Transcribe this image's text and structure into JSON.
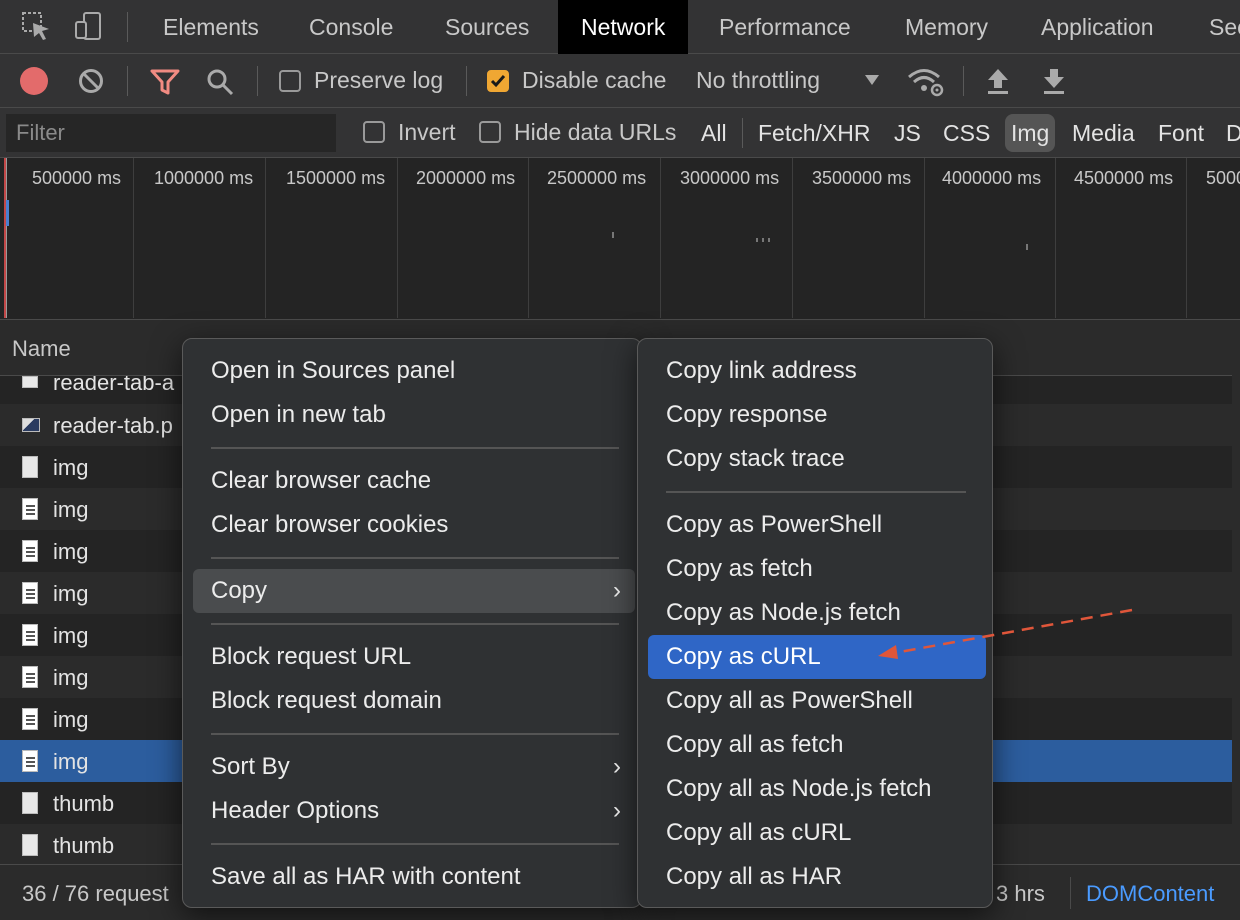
{
  "tabs": [
    {
      "label": "Elements"
    },
    {
      "label": "Console"
    },
    {
      "label": "Sources"
    },
    {
      "label": "Network"
    },
    {
      "label": "Performance"
    },
    {
      "label": "Memory"
    },
    {
      "label": "Application"
    },
    {
      "label": "Sec"
    }
  ],
  "active_tab": "Network",
  "toolbar": {
    "preserve_log_label": "Preserve log",
    "preserve_log_checked": false,
    "disable_cache_label": "Disable cache",
    "disable_cache_checked": true,
    "throttling_value": "No throttling",
    "record_color": "#e36b6b",
    "filter_icon_color": "#f28b82"
  },
  "filterbar": {
    "filter_placeholder": "Filter",
    "invert_label": "Invert",
    "hide_data_urls_label": "Hide data URLs",
    "types": [
      "All",
      "Fetch/XHR",
      "JS",
      "CSS",
      "Img",
      "Media",
      "Font",
      "D"
    ],
    "active_type": "Img"
  },
  "overview": {
    "tick_labels": [
      "500000 ms",
      "1000000 ms",
      "1500000 ms",
      "2000000 ms",
      "2500000 ms",
      "3000000 ms",
      "3500000 ms",
      "4000000 ms",
      "4500000 ms",
      "5000"
    ]
  },
  "list": {
    "header_name": "Name",
    "rows": [
      {
        "name": "reader-tab-a",
        "icon": "file-icon"
      },
      {
        "name": "reader-tab.p",
        "icon": "image-dark-icon"
      },
      {
        "name": "img",
        "icon": "file-icon"
      },
      {
        "name": "img",
        "icon": "image-icon"
      },
      {
        "name": "img",
        "icon": "image-icon"
      },
      {
        "name": "img",
        "icon": "image-icon"
      },
      {
        "name": "img",
        "icon": "image-icon"
      },
      {
        "name": "img",
        "icon": "image-icon"
      },
      {
        "name": "img",
        "icon": "image-icon"
      },
      {
        "name": "img",
        "icon": "image-icon",
        "selected": true
      },
      {
        "name": "thumb",
        "icon": "file-icon"
      },
      {
        "name": "thumb",
        "icon": "file-icon"
      }
    ]
  },
  "status": {
    "requests": "36 / 76 request",
    "finish": "3 hrs",
    "domcontent": "DOMContent"
  },
  "context_menu": {
    "items": [
      {
        "label": "Open in Sources panel"
      },
      {
        "label": "Open in new tab"
      },
      {
        "label": "Clear browser cache"
      },
      {
        "label": "Clear browser cookies"
      },
      {
        "label": "Copy",
        "submenu": true
      },
      {
        "label": "Block request URL"
      },
      {
        "label": "Block request domain"
      },
      {
        "label": "Sort By",
        "submenu": true
      },
      {
        "label": "Header Options",
        "submenu": true
      },
      {
        "label": "Save all as HAR with content"
      }
    ]
  },
  "copy_submenu": {
    "items": [
      {
        "label": "Copy link address"
      },
      {
        "label": "Copy response"
      },
      {
        "label": "Copy stack trace"
      },
      {
        "label": "Copy as PowerShell"
      },
      {
        "label": "Copy as fetch"
      },
      {
        "label": "Copy as Node.js fetch"
      },
      {
        "label": "Copy as cURL"
      },
      {
        "label": "Copy all as PowerShell"
      },
      {
        "label": "Copy all as fetch"
      },
      {
        "label": "Copy all as Node.js fetch"
      },
      {
        "label": "Copy all as cURL"
      },
      {
        "label": "Copy all as HAR"
      }
    ],
    "highlighted": "Copy as cURL",
    "highlight_color": "#2f66c6"
  },
  "annotation": {
    "arrow_color": "#e0563a"
  }
}
